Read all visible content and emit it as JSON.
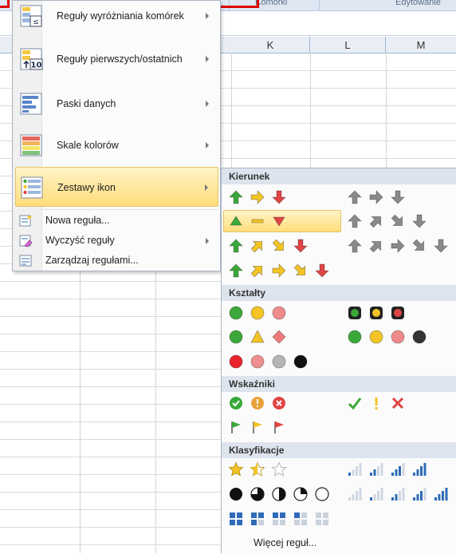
{
  "ribbon": {
    "group_1": "Komórki",
    "group_2": "Edytowanie"
  },
  "columns": [
    "K",
    "L",
    "M"
  ],
  "menu": {
    "items": [
      {
        "label": "Reguły wyróżniania komórek",
        "icon": "highlight-rules-icon"
      },
      {
        "label": "Reguły pierwszych/ostatnich",
        "icon": "top-bottom-rules-icon"
      },
      {
        "label": "Paski danych",
        "icon": "data-bars-icon"
      },
      {
        "label": "Skale kolorów",
        "icon": "color-scales-icon"
      },
      {
        "label": "Zestawy ikon",
        "icon": "icon-sets-icon"
      }
    ],
    "small_items": [
      {
        "label": "Nowa reguła...",
        "icon": "new-rule-icon"
      },
      {
        "label": "Wyczyść reguły",
        "icon": "clear-rules-icon"
      },
      {
        "label": "Zarządzaj regułami...",
        "icon": "manage-rules-icon"
      }
    ]
  },
  "submenu": {
    "sections": {
      "direction": "Kierunek",
      "shapes": "Kształty",
      "indicators": "Wskaźniki",
      "ratings": "Klasyfikacje"
    },
    "more_label": "Więcej reguł..."
  },
  "colors": {
    "highlight": "#ffdd7a",
    "green": "#3aa83a",
    "yellow": "#f2c425",
    "red": "#e04545",
    "gray": "#8a8a8a"
  }
}
